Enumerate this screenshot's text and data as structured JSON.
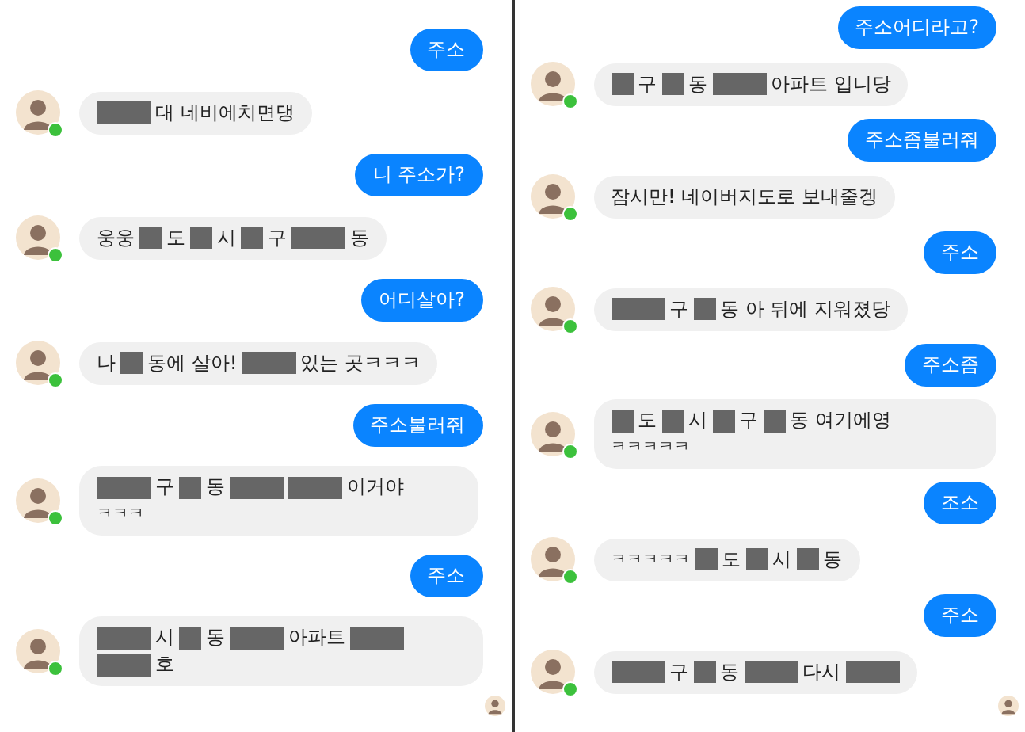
{
  "panels": [
    {
      "messages": [
        {
          "kind": "me",
          "text": "주소"
        },
        {
          "kind": "them",
          "online": true,
          "parts": [
            {
              "kind": "long"
            },
            {
              "kind": "text",
              "text": "대 네비에치면댕"
            }
          ]
        },
        {
          "kind": "me",
          "text": "니 주소가?"
        },
        {
          "kind": "them",
          "online": true,
          "parts": [
            {
              "kind": "text",
              "text": "웅웅"
            },
            {
              "kind": "short"
            },
            {
              "kind": "text",
              "text": "도"
            },
            {
              "kind": "short"
            },
            {
              "kind": "text",
              "text": "시"
            },
            {
              "kind": "short"
            },
            {
              "kind": "text",
              "text": "구"
            },
            {
              "kind": "long"
            },
            {
              "kind": "text",
              "text": "동"
            }
          ]
        },
        {
          "kind": "me",
          "text": "어디살아?"
        },
        {
          "kind": "them",
          "online": true,
          "parts": [
            {
              "kind": "text",
              "text": "나"
            },
            {
              "kind": "short"
            },
            {
              "kind": "text",
              "text": "동에 살아!"
            },
            {
              "kind": "long"
            },
            {
              "kind": "text",
              "text": "있는 곳ㅋㅋㅋ"
            }
          ]
        },
        {
          "kind": "me",
          "text": "주소불러줘"
        },
        {
          "kind": "them",
          "online": true,
          "parts": [
            {
              "kind": "long"
            },
            {
              "kind": "text",
              "text": "구"
            },
            {
              "kind": "short"
            },
            {
              "kind": "text",
              "text": "동"
            },
            {
              "kind": "long"
            },
            {
              "kind": "long"
            },
            {
              "kind": "text",
              "text": "이거야"
            },
            {
              "kind": "break"
            },
            {
              "kind": "small",
              "text": "ㅋㅋㅋ"
            }
          ]
        },
        {
          "kind": "me",
          "text": "주소"
        },
        {
          "kind": "them",
          "online": true,
          "parts": [
            {
              "kind": "long"
            },
            {
              "kind": "text",
              "text": "시"
            },
            {
              "kind": "short"
            },
            {
              "kind": "text",
              "text": "동"
            },
            {
              "kind": "long"
            },
            {
              "kind": "text",
              "text": "아파트"
            },
            {
              "kind": "long"
            },
            {
              "kind": "break"
            },
            {
              "kind": "long"
            },
            {
              "kind": "text",
              "text": "호"
            }
          ]
        }
      ]
    },
    {
      "messages": [
        {
          "kind": "me",
          "text": "주소어디라고?"
        },
        {
          "kind": "them",
          "online": true,
          "parts": [
            {
              "kind": "short"
            },
            {
              "kind": "text",
              "text": "구"
            },
            {
              "kind": "short"
            },
            {
              "kind": "text",
              "text": "동"
            },
            {
              "kind": "long"
            },
            {
              "kind": "text",
              "text": "아파트 입니당"
            }
          ]
        },
        {
          "kind": "me",
          "text": "주소좀불러줘"
        },
        {
          "kind": "them",
          "online": true,
          "parts": [
            {
              "kind": "text",
              "text": "잠시만! 네이버지도로 보내줄겡"
            }
          ]
        },
        {
          "kind": "me",
          "text": "주소"
        },
        {
          "kind": "them",
          "online": true,
          "parts": [
            {
              "kind": "long"
            },
            {
              "kind": "text",
              "text": "구"
            },
            {
              "kind": "short"
            },
            {
              "kind": "text",
              "text": "동 아 뒤에 지워졌당"
            }
          ]
        },
        {
          "kind": "me",
          "text": "주소좀"
        },
        {
          "kind": "them",
          "online": true,
          "parts": [
            {
              "kind": "short"
            },
            {
              "kind": "text",
              "text": "도"
            },
            {
              "kind": "short"
            },
            {
              "kind": "text",
              "text": "시"
            },
            {
              "kind": "short"
            },
            {
              "kind": "text",
              "text": "구"
            },
            {
              "kind": "short"
            },
            {
              "kind": "text",
              "text": "동 여기에영"
            },
            {
              "kind": "break"
            },
            {
              "kind": "small",
              "text": "ㅋㅋㅋㅋㅋ"
            }
          ]
        },
        {
          "kind": "me",
          "text": "조소"
        },
        {
          "kind": "them",
          "online": true,
          "parts": [
            {
              "kind": "small",
              "text": "ㅋㅋㅋㅋㅋ"
            },
            {
              "kind": "short"
            },
            {
              "kind": "text",
              "text": "도"
            },
            {
              "kind": "short"
            },
            {
              "kind": "text",
              "text": "시"
            },
            {
              "kind": "short"
            },
            {
              "kind": "text",
              "text": "동"
            }
          ]
        },
        {
          "kind": "me",
          "text": "주소"
        },
        {
          "kind": "them",
          "online": true,
          "parts": [
            {
              "kind": "long"
            },
            {
              "kind": "text",
              "text": "구"
            },
            {
              "kind": "short"
            },
            {
              "kind": "text",
              "text": "동"
            },
            {
              "kind": "long"
            },
            {
              "kind": "text",
              "text": "다시"
            },
            {
              "kind": "long"
            }
          ]
        }
      ]
    }
  ]
}
